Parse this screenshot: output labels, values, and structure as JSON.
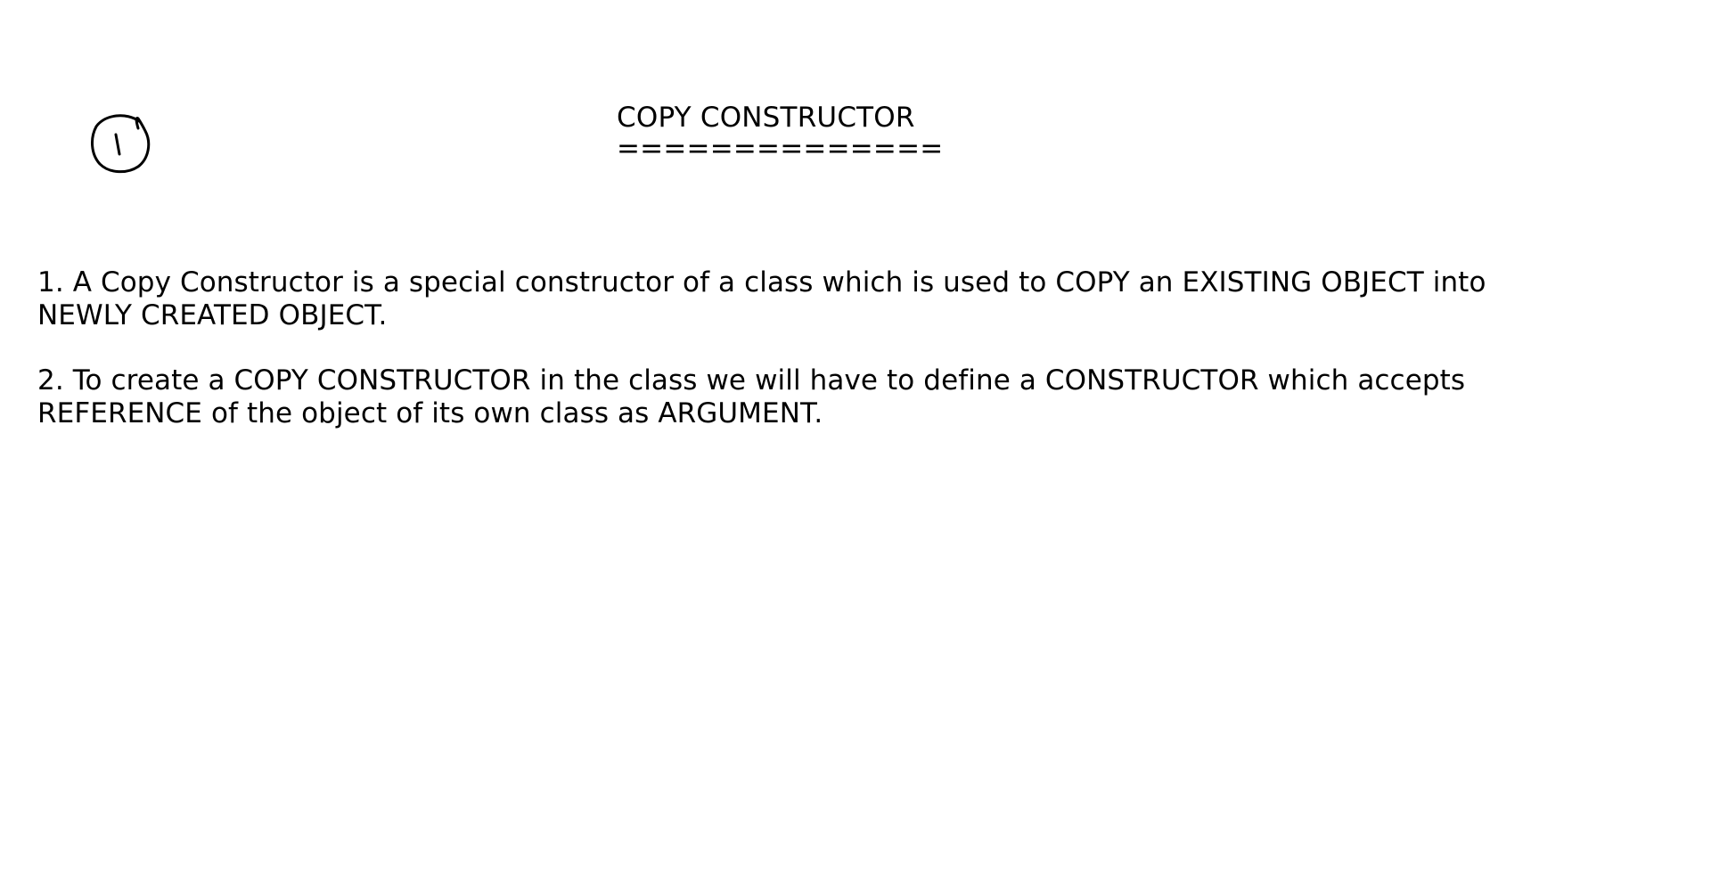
{
  "page": {
    "title": "COPY CONSTRUCTOR",
    "title_underline": "==============",
    "annotation_icon": "handwritten-circled-number-icon",
    "points": [
      {
        "line1": "1. A Copy Constructor is a special constructor of a class which is used to COPY an EXISTING OBJECT into",
        "line2": "NEWLY CREATED OBJECT."
      },
      {
        "line1": "2. To create a COPY CONSTRUCTOR in the class we will have to define a CONSTRUCTOR which accepts",
        "line2": "REFERENCE of the object of its own class as ARGUMENT."
      }
    ]
  }
}
